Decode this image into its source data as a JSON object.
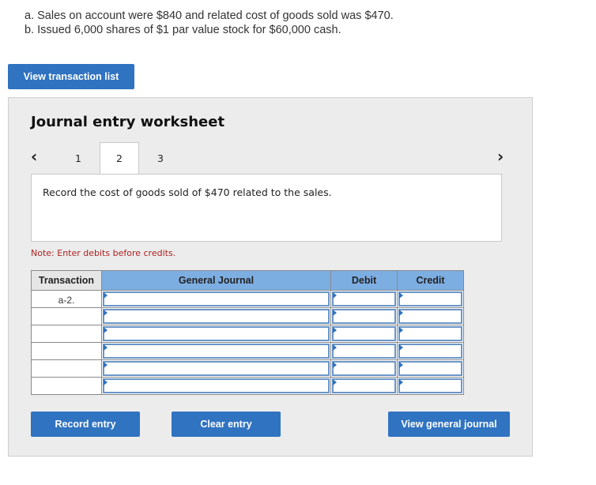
{
  "intro": {
    "line_a": "a. Sales on account were $840 and related cost of goods sold was $470.",
    "line_b": "b. Issued 6,000 shares of $1 par value stock for $60,000 cash."
  },
  "buttons": {
    "view_transaction_list": "View transaction list",
    "record_entry": "Record entry",
    "clear_entry": "Clear entry",
    "view_general_journal": "View general journal"
  },
  "worksheet": {
    "title": "Journal entry worksheet",
    "tabs": [
      "1",
      "2",
      "3"
    ],
    "active_tab": "2",
    "instruction": "Record the cost of goods sold of $470 related to the sales.",
    "note": "Note: Enter debits before credits."
  },
  "journal": {
    "headers": {
      "transaction": "Transaction",
      "general_journal": "General Journal",
      "debit": "Debit",
      "credit": "Credit"
    },
    "rows": [
      {
        "transaction": "a-2."
      },
      {
        "transaction": ""
      },
      {
        "transaction": ""
      },
      {
        "transaction": ""
      },
      {
        "transaction": ""
      },
      {
        "transaction": ""
      }
    ]
  },
  "colors": {
    "button_blue": "#2f73c1",
    "header_blue": "#7daee2",
    "note_red": "#b02020",
    "panel_gray": "#ececec"
  },
  "icons": {
    "prev": "chevron-left-icon",
    "next": "chevron-right-icon"
  }
}
